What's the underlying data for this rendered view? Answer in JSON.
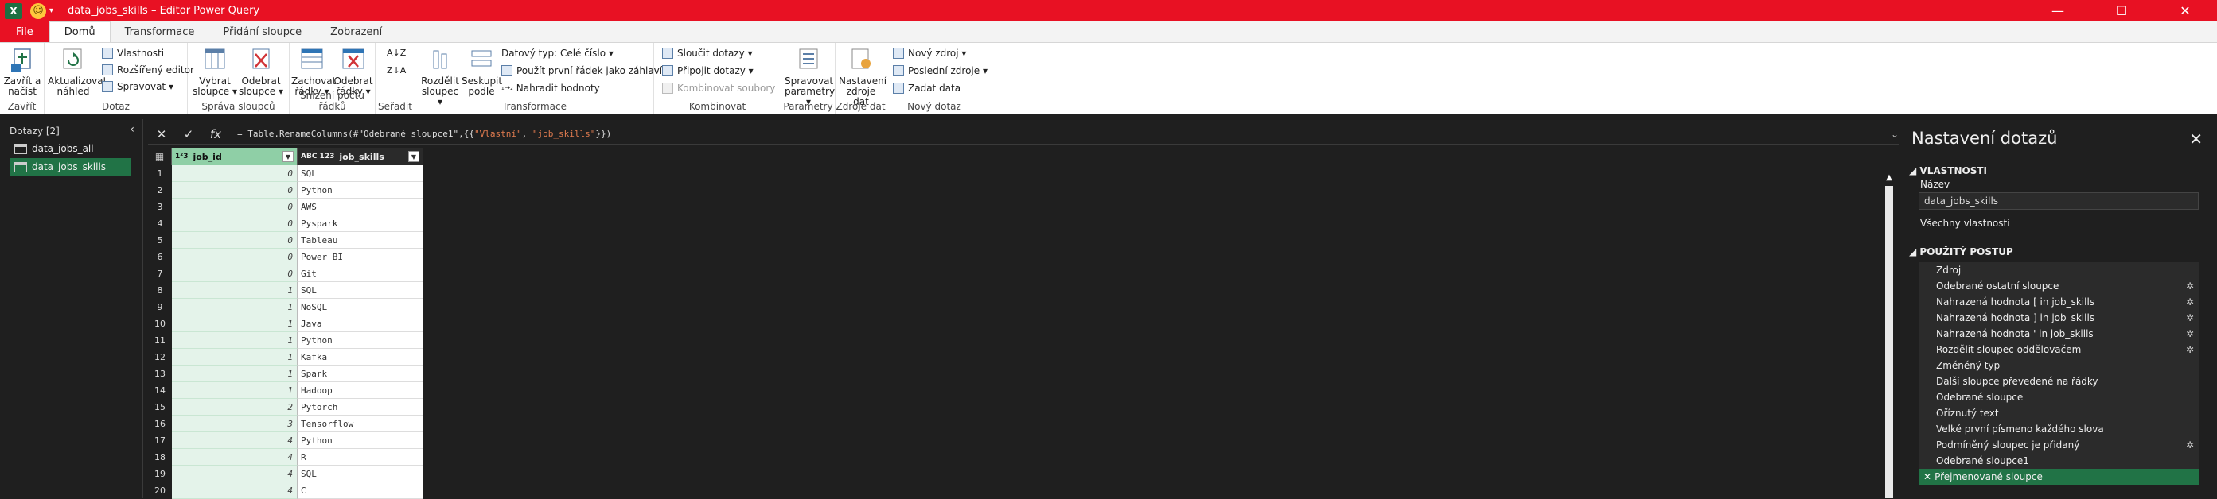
{
  "titlebar": {
    "app_icon": "X",
    "title": "data_jobs_skills – Editor Power Query",
    "minimize": "—",
    "maximize": "☐",
    "close": "✕"
  },
  "tabs": [
    "File",
    "Domů",
    "Transformace",
    "Přidání sloupce",
    "Zobrazení"
  ],
  "ribbon": {
    "close_load": "Zavřít a načíst",
    "group_close": "Zavřít",
    "refresh_preview": "Aktualizovat náhled",
    "properties": "Vlastnosti",
    "advanced_editor": "Rozšířený editor",
    "manage": "Spravovat",
    "group_query": "Dotaz",
    "choose_columns": "Vybrat sloupce",
    "remove_columns": "Odebrat sloupce",
    "group_manage_columns": "Správa sloupců",
    "keep_rows": "Zachovat řádky",
    "remove_rows": "Odebrat řádky",
    "group_reduce_rows": "Snížení počtu řádků",
    "group_sort": "Seřadit",
    "split_column": "Rozdělit sloupec",
    "group_by": "Seskupit podle",
    "data_type": "Datový typ: Celé číslo",
    "first_row_header": "Použít první řádek jako záhlaví",
    "replace_values": "Nahradit hodnoty",
    "group_transform": "Transformace",
    "merge_queries": "Sloučit dotazy",
    "append_queries": "Připojit dotazy",
    "combine_files": "Kombinovat soubory",
    "group_combine": "Kombinovat",
    "manage_parameters": "Spravovat parametry",
    "group_parameters": "Parametry",
    "data_source_settings": "Nastavení zdroje dat",
    "group_data_sources": "Zdroje dat",
    "new_source": "Nový zdroj",
    "recent_sources": "Poslední zdroje",
    "enter_data": "Zadat data",
    "group_new_query": "Nový dotaz"
  },
  "queries": {
    "header": "Dotazy [2]",
    "items": [
      "data_jobs_all",
      "data_jobs_skills"
    ]
  },
  "formula": {
    "prefix": "= Table.RenameColumns(#\"Odebrané sloupce1\",{{",
    "str1": "\"Vlastní\"",
    "sep": ", ",
    "str2": "\"job_skills\"",
    "suffix": "}})"
  },
  "grid": {
    "columns": [
      {
        "type_icon": "1²3",
        "name": "job_id"
      },
      {
        "type_icon": "ABC 123",
        "name": "job_skills"
      }
    ],
    "rows": [
      {
        "n": "1",
        "job_id": "0",
        "job_skills": "SQL"
      },
      {
        "n": "2",
        "job_id": "0",
        "job_skills": "Python"
      },
      {
        "n": "3",
        "job_id": "0",
        "job_skills": "AWS"
      },
      {
        "n": "4",
        "job_id": "0",
        "job_skills": "Pyspark"
      },
      {
        "n": "5",
        "job_id": "0",
        "job_skills": "Tableau"
      },
      {
        "n": "6",
        "job_id": "0",
        "job_skills": "Power BI"
      },
      {
        "n": "7",
        "job_id": "0",
        "job_skills": "Git"
      },
      {
        "n": "8",
        "job_id": "1",
        "job_skills": "SQL"
      },
      {
        "n": "9",
        "job_id": "1",
        "job_skills": "NoSQL"
      },
      {
        "n": "10",
        "job_id": "1",
        "job_skills": "Java"
      },
      {
        "n": "11",
        "job_id": "1",
        "job_skills": "Python"
      },
      {
        "n": "12",
        "job_id": "1",
        "job_skills": "Kafka"
      },
      {
        "n": "13",
        "job_id": "1",
        "job_skills": "Spark"
      },
      {
        "n": "14",
        "job_id": "1",
        "job_skills": "Hadoop"
      },
      {
        "n": "15",
        "job_id": "2",
        "job_skills": "Pytorch"
      },
      {
        "n": "16",
        "job_id": "3",
        "job_skills": "Tensorflow"
      },
      {
        "n": "17",
        "job_id": "4",
        "job_skills": "Python"
      },
      {
        "n": "18",
        "job_id": "4",
        "job_skills": "R"
      },
      {
        "n": "19",
        "job_id": "4",
        "job_skills": "SQL"
      },
      {
        "n": "20",
        "job_id": "4",
        "job_skills": "C"
      }
    ]
  },
  "settings": {
    "title": "Nastavení dotazů",
    "properties_header": "VLASTNOSTI",
    "name_label": "Název",
    "name_value": "data_jobs_skills",
    "all_properties": "Všechny vlastnosti",
    "steps_header": "POUŽITÝ POSTUP",
    "steps": [
      {
        "label": "Zdroj",
        "gear": false
      },
      {
        "label": "Odebrané ostatní sloupce",
        "gear": true
      },
      {
        "label": "Nahrazená hodnota [ in job_skills",
        "gear": true
      },
      {
        "label": "Nahrazená hodnota ] in job_skills",
        "gear": true
      },
      {
        "label": "Nahrazená hodnota ' in job_skills",
        "gear": true
      },
      {
        "label": "Rozdělit sloupec oddělovačem",
        "gear": true
      },
      {
        "label": "Změněný typ",
        "gear": false
      },
      {
        "label": "Další sloupce převedené na řádky",
        "gear": false
      },
      {
        "label": "Odebrané sloupce",
        "gear": false
      },
      {
        "label": "Oříznutý text",
        "gear": false
      },
      {
        "label": "Velké první písmeno každého slova",
        "gear": false
      },
      {
        "label": "Podmíněný sloupec je přidaný",
        "gear": true
      },
      {
        "label": "Odebrané sloupce1",
        "gear": false
      },
      {
        "label": "Přejmenované sloupce",
        "gear": false,
        "selected": true
      }
    ]
  },
  "colors": {
    "accent": "#e81123",
    "excel_green": "#217346",
    "column_selected": "#8fcfa6"
  }
}
